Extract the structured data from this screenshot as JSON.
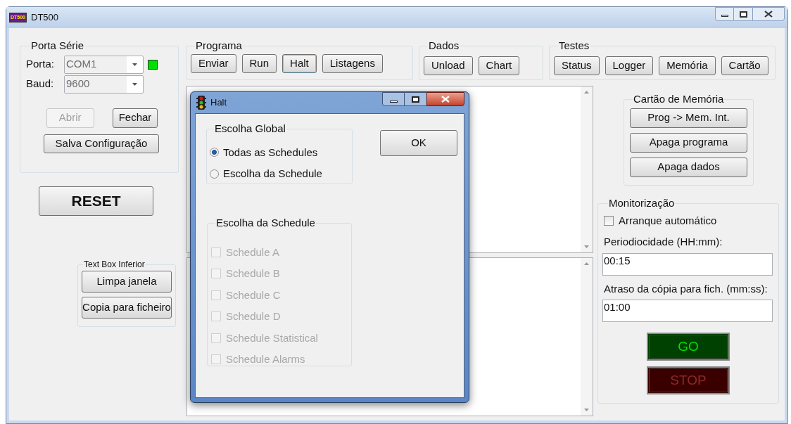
{
  "window": {
    "title": "DT500",
    "icon_text": "DT500"
  },
  "porta_serie": {
    "title": "Porta Série",
    "fields": [
      {
        "label": "Porta:",
        "value": "COM1",
        "indicator": true
      },
      {
        "label": "Baud:",
        "value": "9600"
      }
    ],
    "buttons": [
      {
        "label": "Abrir",
        "disabled": true
      },
      {
        "label": "Fechar",
        "disabled": false
      }
    ],
    "save_button": "Salva Configuração"
  },
  "reset_button": "RESET",
  "text_box_inferior": {
    "title": "Text Box Inferior",
    "buttons": [
      "Limpa janela",
      "Copia para ficheiro"
    ]
  },
  "toolbar_groups": [
    {
      "title": "Programa",
      "buttons": [
        {
          "label": "Enviar",
          "focused": false
        },
        {
          "label": "Run",
          "focused": false
        },
        {
          "label": "Halt",
          "focused": true
        },
        {
          "label": "Listagens",
          "focused": false
        }
      ]
    },
    {
      "title": "Dados",
      "buttons": [
        {
          "label": "Unload",
          "focused": false
        },
        {
          "label": "Chart",
          "focused": false
        }
      ]
    },
    {
      "title": "Testes",
      "buttons": [
        {
          "label": "Status",
          "focused": false
        },
        {
          "label": "Logger",
          "focused": false
        },
        {
          "label": "Memória",
          "focused": false
        },
        {
          "label": "Cartão",
          "focused": false
        }
      ]
    }
  ],
  "cartao_memoria": {
    "title": "Cartão de Memória",
    "buttons": [
      "Prog -> Mem. Int.",
      "Apaga programa",
      "Apaga dados"
    ]
  },
  "monitorizacao": {
    "title": "Monitorização",
    "auto_start": {
      "label": "Arranque automático",
      "checked": false
    },
    "fields": [
      {
        "label": "Periodiocidade (HH:mm):",
        "value": "00:15"
      },
      {
        "label": "Atraso da cópia para fich. (mm:ss):",
        "value": "01:00"
      }
    ],
    "run_buttons": [
      {
        "label": "GO",
        "kind": "go",
        "on": true
      },
      {
        "label": "STOP",
        "kind": "stop",
        "on": false
      }
    ]
  },
  "dialog": {
    "title": "Halt",
    "ok_button": "OK",
    "global_group": {
      "title": "Escolha Global",
      "options": [
        {
          "label": "Todas as Schedules",
          "selected": true
        },
        {
          "label": "Escolha da Schedule",
          "selected": false
        }
      ]
    },
    "schedule_group": {
      "title": "Escolha da Schedule",
      "options": [
        {
          "label": "Schedule A",
          "checked": false,
          "disabled": true
        },
        {
          "label": "Schedule B",
          "checked": false,
          "disabled": true
        },
        {
          "label": "Schedule C",
          "checked": false,
          "disabled": true
        },
        {
          "label": "Schedule D",
          "checked": false,
          "disabled": true
        },
        {
          "label": "Schedule Statistical",
          "checked": false,
          "disabled": true
        },
        {
          "label": "Schedule Alarms",
          "checked": false,
          "disabled": true
        }
      ]
    }
  }
}
